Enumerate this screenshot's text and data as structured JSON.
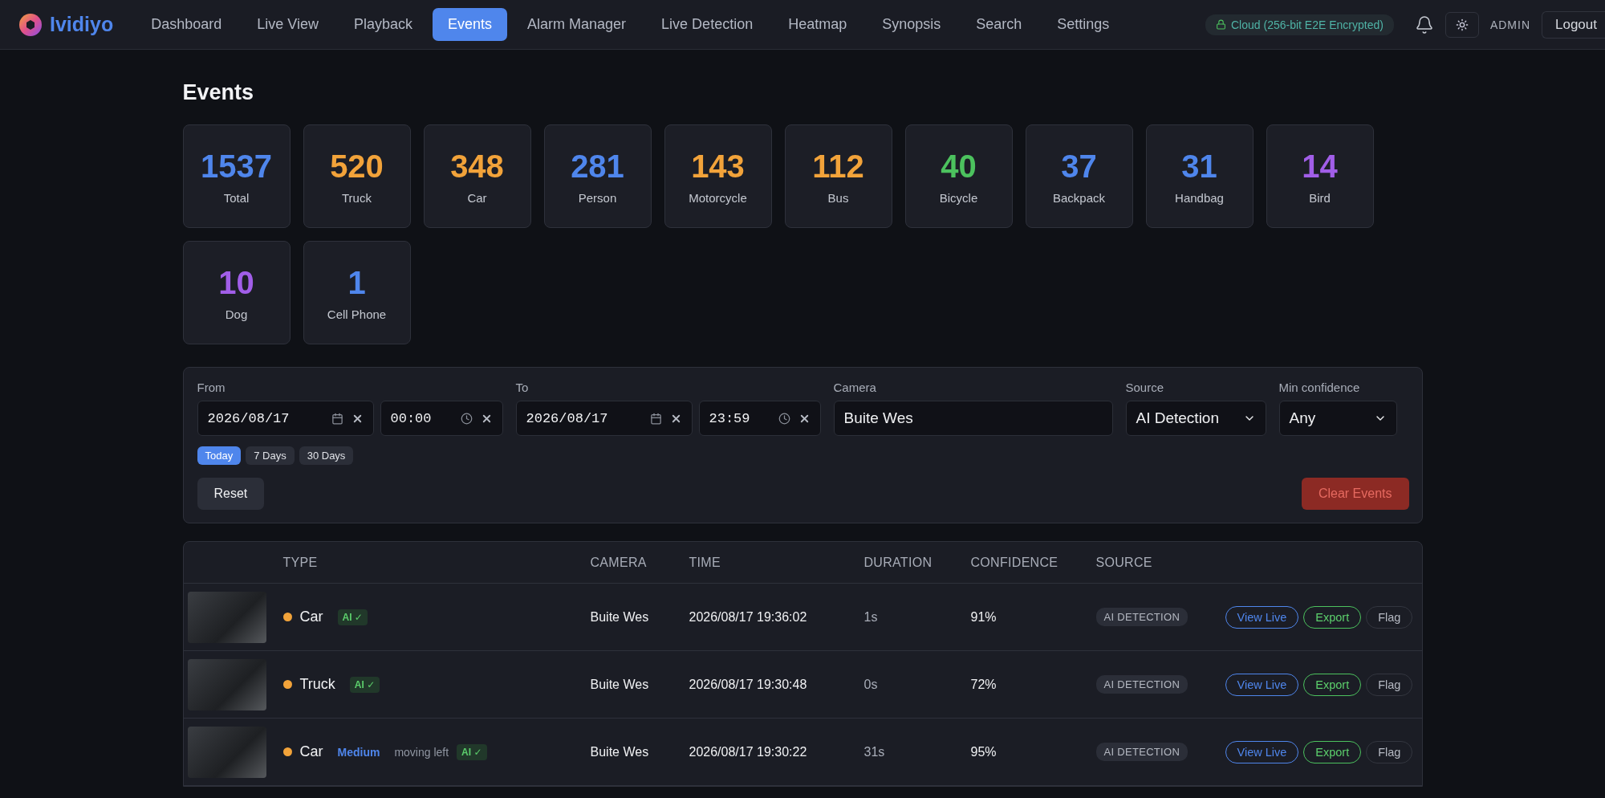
{
  "header": {
    "brand": "Ividiyo",
    "nav": [
      {
        "label": "Dashboard",
        "selected": false
      },
      {
        "label": "Live View",
        "selected": false
      },
      {
        "label": "Playback",
        "selected": false
      },
      {
        "label": "Events",
        "selected": true
      },
      {
        "label": "Alarm Manager",
        "selected": false
      },
      {
        "label": "Live Detection",
        "selected": false
      },
      {
        "label": "Heatmap",
        "selected": false
      },
      {
        "label": "Synopsis",
        "selected": false
      },
      {
        "label": "Search",
        "selected": false
      },
      {
        "label": "Settings",
        "selected": false
      }
    ],
    "cloud_status": "Cloud (256-bit E2E Encrypted)",
    "user": "ADMIN",
    "logout": "Logout"
  },
  "page_title": "Events",
  "stats": [
    {
      "count": "1537",
      "label": "Total",
      "color": "#4f86ec"
    },
    {
      "count": "520",
      "label": "Truck",
      "color": "#f2a33a"
    },
    {
      "count": "348",
      "label": "Car",
      "color": "#f2a33a"
    },
    {
      "count": "281",
      "label": "Person",
      "color": "#4f86ec"
    },
    {
      "count": "143",
      "label": "Motorcycle",
      "color": "#f2a33a"
    },
    {
      "count": "112",
      "label": "Bus",
      "color": "#f2a33a"
    },
    {
      "count": "40",
      "label": "Bicycle",
      "color": "#4cc25e"
    },
    {
      "count": "37",
      "label": "Backpack",
      "color": "#4f86ec"
    },
    {
      "count": "31",
      "label": "Handbag",
      "color": "#4f86ec"
    },
    {
      "count": "14",
      "label": "Bird",
      "color": "#a15ee8"
    },
    {
      "count": "10",
      "label": "Dog",
      "color": "#a15ee8"
    },
    {
      "count": "1",
      "label": "Cell Phone",
      "color": "#4f86ec"
    }
  ],
  "filters": {
    "from": {
      "label": "From",
      "date": "2026/08/17",
      "time": "00:00"
    },
    "to": {
      "label": "To",
      "date": "2026/08/17",
      "time": "23:59"
    },
    "presets": [
      {
        "label": "Today",
        "selected": true
      },
      {
        "label": "7 Days",
        "selected": false
      },
      {
        "label": "30 Days",
        "selected": false
      }
    ],
    "camera": {
      "label": "Camera",
      "value": "Buite Wes"
    },
    "source": {
      "label": "Source",
      "value": "AI Detection"
    },
    "min_confidence": {
      "label": "Min confidence",
      "value": "Any"
    },
    "reset": "Reset",
    "clear": "Clear Events"
  },
  "table": {
    "columns": [
      "TYPE",
      "CAMERA",
      "TIME",
      "DURATION",
      "CONFIDENCE",
      "SOURCE"
    ],
    "rows": [
      {
        "type": "Car",
        "color": "#f2a33a",
        "tags": [
          {
            "kind": "ai",
            "text": "AI ✓"
          }
        ],
        "camera": "Buite Wes",
        "time": "2026/08/17 19:36:02",
        "duration": "1s",
        "confidence": "91%",
        "source": "AI DETECTION",
        "actions": [
          "View Live",
          "Export",
          "Flag"
        ]
      },
      {
        "type": "Truck",
        "color": "#f2a33a",
        "tags": [
          {
            "kind": "ai",
            "text": "AI ✓"
          }
        ],
        "camera": "Buite Wes",
        "time": "2026/08/17 19:30:48",
        "duration": "0s",
        "confidence": "72%",
        "source": "AI DETECTION",
        "actions": [
          "View Live",
          "Export",
          "Flag"
        ]
      },
      {
        "type": "Car",
        "color": "#f2a33a",
        "tags": [
          {
            "kind": "size",
            "text": "Medium"
          },
          {
            "kind": "direction",
            "text": "moving left"
          },
          {
            "kind": "ai",
            "text": "AI ✓"
          }
        ],
        "camera": "Buite Wes",
        "time": "2026/08/17 19:30:22",
        "duration": "31s",
        "confidence": "95%",
        "source": "AI DETECTION",
        "actions": [
          "View Live",
          "Export",
          "Flag"
        ]
      }
    ]
  }
}
